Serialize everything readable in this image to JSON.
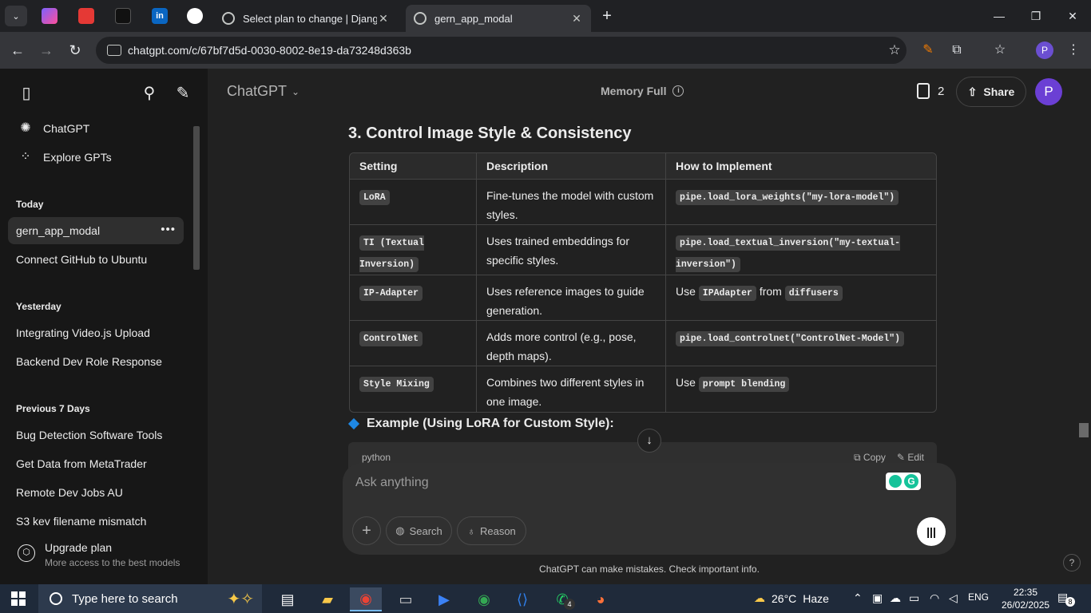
{
  "browser": {
    "tabs": [
      {
        "label": "Select plan to change | Django",
        "active": false
      },
      {
        "label": "gern_app_modal",
        "active": true
      }
    ],
    "url": "chatgpt.com/c/67bf7d5d-0030-8002-8e19-da73248d363b",
    "profile_initial": "P"
  },
  "sidebar": {
    "top_items": [
      {
        "label": "ChatGPT",
        "icon": "openai-logo-icon"
      },
      {
        "label": "Explore GPTs",
        "icon": "grid-icon"
      }
    ],
    "sections": [
      {
        "title": "Today",
        "items": [
          "gern_app_modal",
          "Connect GitHub to Ubuntu"
        ]
      },
      {
        "title": "Yesterday",
        "items": [
          "Integrating Video.js Upload",
          "Backend Dev Role Response"
        ]
      },
      {
        "title": "Previous 7 Days",
        "items": [
          "Bug Detection Software Tools",
          "Get Data from MetaTrader",
          "Remote Dev Jobs AU",
          "S3 key filename mismatch"
        ]
      }
    ],
    "upgrade": {
      "title": "Upgrade plan",
      "subtitle": "More access to the best models"
    }
  },
  "header": {
    "model": "ChatGPT",
    "memory": "Memory Full",
    "doc_count": "2",
    "share": "Share",
    "avatar": "P"
  },
  "content": {
    "heading": "3. Control Image Style & Consistency",
    "table": {
      "headers": [
        "Setting",
        "Description",
        "How to Implement"
      ],
      "rows": [
        {
          "setting": "LoRA",
          "desc": "Fine-tunes the model with custom styles.",
          "impl_code": "pipe.load_lora_weights(\"my-lora-model\")"
        },
        {
          "setting": "TI (Textual Inversion)",
          "desc": "Uses trained embeddings for specific styles.",
          "impl_code": "pipe.load_textual_inversion(\"my-textual-inversion\")"
        },
        {
          "setting": "IP-Adapter",
          "desc": "Uses reference images to guide generation.",
          "impl_pre": "Use",
          "impl_code": "IPAdapter",
          "impl_mid": "from",
          "impl_code2": "diffusers"
        },
        {
          "setting": "ControlNet",
          "desc": "Adds more control (e.g., pose, depth maps).",
          "impl_code": "pipe.load_controlnet(\"ControlNet-Model\")"
        },
        {
          "setting": "Style Mixing",
          "desc": "Combines two different styles in one image.",
          "impl_pre": "Use",
          "impl_code": "prompt blending"
        }
      ]
    },
    "example_title": "Example (Using LoRA for Custom Style):",
    "code_lang": "python",
    "copy": "Copy",
    "edit": "Edit"
  },
  "composer": {
    "placeholder": "Ask anything",
    "search": "Search",
    "reason": "Reason"
  },
  "disclaimer": "ChatGPT can make mistakes. Check important info.",
  "taskbar": {
    "search_placeholder": "Type here to search",
    "temperature": "26°C",
    "weather": "Haze",
    "lang": "ENG",
    "time": "22:35",
    "date": "26/02/2025",
    "whatsapp_badge": "4",
    "notif_count": "8"
  },
  "colors": {
    "accent": "#6b3fd4",
    "diamond": "#1e88e5",
    "taskbar": "#1f2a3a"
  }
}
